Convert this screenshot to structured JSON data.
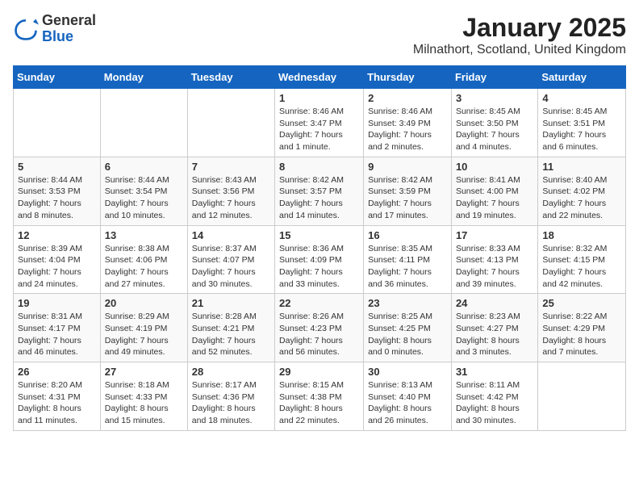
{
  "logo": {
    "general": "General",
    "blue": "Blue"
  },
  "title": "January 2025",
  "location": "Milnathort, Scotland, United Kingdom",
  "days_of_week": [
    "Sunday",
    "Monday",
    "Tuesday",
    "Wednesday",
    "Thursday",
    "Friday",
    "Saturday"
  ],
  "weeks": [
    [
      {
        "day": "",
        "info": ""
      },
      {
        "day": "",
        "info": ""
      },
      {
        "day": "",
        "info": ""
      },
      {
        "day": "1",
        "info": "Sunrise: 8:46 AM\nSunset: 3:47 PM\nDaylight: 7 hours\nand 1 minute."
      },
      {
        "day": "2",
        "info": "Sunrise: 8:46 AM\nSunset: 3:49 PM\nDaylight: 7 hours\nand 2 minutes."
      },
      {
        "day": "3",
        "info": "Sunrise: 8:45 AM\nSunset: 3:50 PM\nDaylight: 7 hours\nand 4 minutes."
      },
      {
        "day": "4",
        "info": "Sunrise: 8:45 AM\nSunset: 3:51 PM\nDaylight: 7 hours\nand 6 minutes."
      }
    ],
    [
      {
        "day": "5",
        "info": "Sunrise: 8:44 AM\nSunset: 3:53 PM\nDaylight: 7 hours\nand 8 minutes."
      },
      {
        "day": "6",
        "info": "Sunrise: 8:44 AM\nSunset: 3:54 PM\nDaylight: 7 hours\nand 10 minutes."
      },
      {
        "day": "7",
        "info": "Sunrise: 8:43 AM\nSunset: 3:56 PM\nDaylight: 7 hours\nand 12 minutes."
      },
      {
        "day": "8",
        "info": "Sunrise: 8:42 AM\nSunset: 3:57 PM\nDaylight: 7 hours\nand 14 minutes."
      },
      {
        "day": "9",
        "info": "Sunrise: 8:42 AM\nSunset: 3:59 PM\nDaylight: 7 hours\nand 17 minutes."
      },
      {
        "day": "10",
        "info": "Sunrise: 8:41 AM\nSunset: 4:00 PM\nDaylight: 7 hours\nand 19 minutes."
      },
      {
        "day": "11",
        "info": "Sunrise: 8:40 AM\nSunset: 4:02 PM\nDaylight: 7 hours\nand 22 minutes."
      }
    ],
    [
      {
        "day": "12",
        "info": "Sunrise: 8:39 AM\nSunset: 4:04 PM\nDaylight: 7 hours\nand 24 minutes."
      },
      {
        "day": "13",
        "info": "Sunrise: 8:38 AM\nSunset: 4:06 PM\nDaylight: 7 hours\nand 27 minutes."
      },
      {
        "day": "14",
        "info": "Sunrise: 8:37 AM\nSunset: 4:07 PM\nDaylight: 7 hours\nand 30 minutes."
      },
      {
        "day": "15",
        "info": "Sunrise: 8:36 AM\nSunset: 4:09 PM\nDaylight: 7 hours\nand 33 minutes."
      },
      {
        "day": "16",
        "info": "Sunrise: 8:35 AM\nSunset: 4:11 PM\nDaylight: 7 hours\nand 36 minutes."
      },
      {
        "day": "17",
        "info": "Sunrise: 8:33 AM\nSunset: 4:13 PM\nDaylight: 7 hours\nand 39 minutes."
      },
      {
        "day": "18",
        "info": "Sunrise: 8:32 AM\nSunset: 4:15 PM\nDaylight: 7 hours\nand 42 minutes."
      }
    ],
    [
      {
        "day": "19",
        "info": "Sunrise: 8:31 AM\nSunset: 4:17 PM\nDaylight: 7 hours\nand 46 minutes."
      },
      {
        "day": "20",
        "info": "Sunrise: 8:29 AM\nSunset: 4:19 PM\nDaylight: 7 hours\nand 49 minutes."
      },
      {
        "day": "21",
        "info": "Sunrise: 8:28 AM\nSunset: 4:21 PM\nDaylight: 7 hours\nand 52 minutes."
      },
      {
        "day": "22",
        "info": "Sunrise: 8:26 AM\nSunset: 4:23 PM\nDaylight: 7 hours\nand 56 minutes."
      },
      {
        "day": "23",
        "info": "Sunrise: 8:25 AM\nSunset: 4:25 PM\nDaylight: 8 hours\nand 0 minutes."
      },
      {
        "day": "24",
        "info": "Sunrise: 8:23 AM\nSunset: 4:27 PM\nDaylight: 8 hours\nand 3 minutes."
      },
      {
        "day": "25",
        "info": "Sunrise: 8:22 AM\nSunset: 4:29 PM\nDaylight: 8 hours\nand 7 minutes."
      }
    ],
    [
      {
        "day": "26",
        "info": "Sunrise: 8:20 AM\nSunset: 4:31 PM\nDaylight: 8 hours\nand 11 minutes."
      },
      {
        "day": "27",
        "info": "Sunrise: 8:18 AM\nSunset: 4:33 PM\nDaylight: 8 hours\nand 15 minutes."
      },
      {
        "day": "28",
        "info": "Sunrise: 8:17 AM\nSunset: 4:36 PM\nDaylight: 8 hours\nand 18 minutes."
      },
      {
        "day": "29",
        "info": "Sunrise: 8:15 AM\nSunset: 4:38 PM\nDaylight: 8 hours\nand 22 minutes."
      },
      {
        "day": "30",
        "info": "Sunrise: 8:13 AM\nSunset: 4:40 PM\nDaylight: 8 hours\nand 26 minutes."
      },
      {
        "day": "31",
        "info": "Sunrise: 8:11 AM\nSunset: 4:42 PM\nDaylight: 8 hours\nand 30 minutes."
      },
      {
        "day": "",
        "info": ""
      }
    ]
  ]
}
